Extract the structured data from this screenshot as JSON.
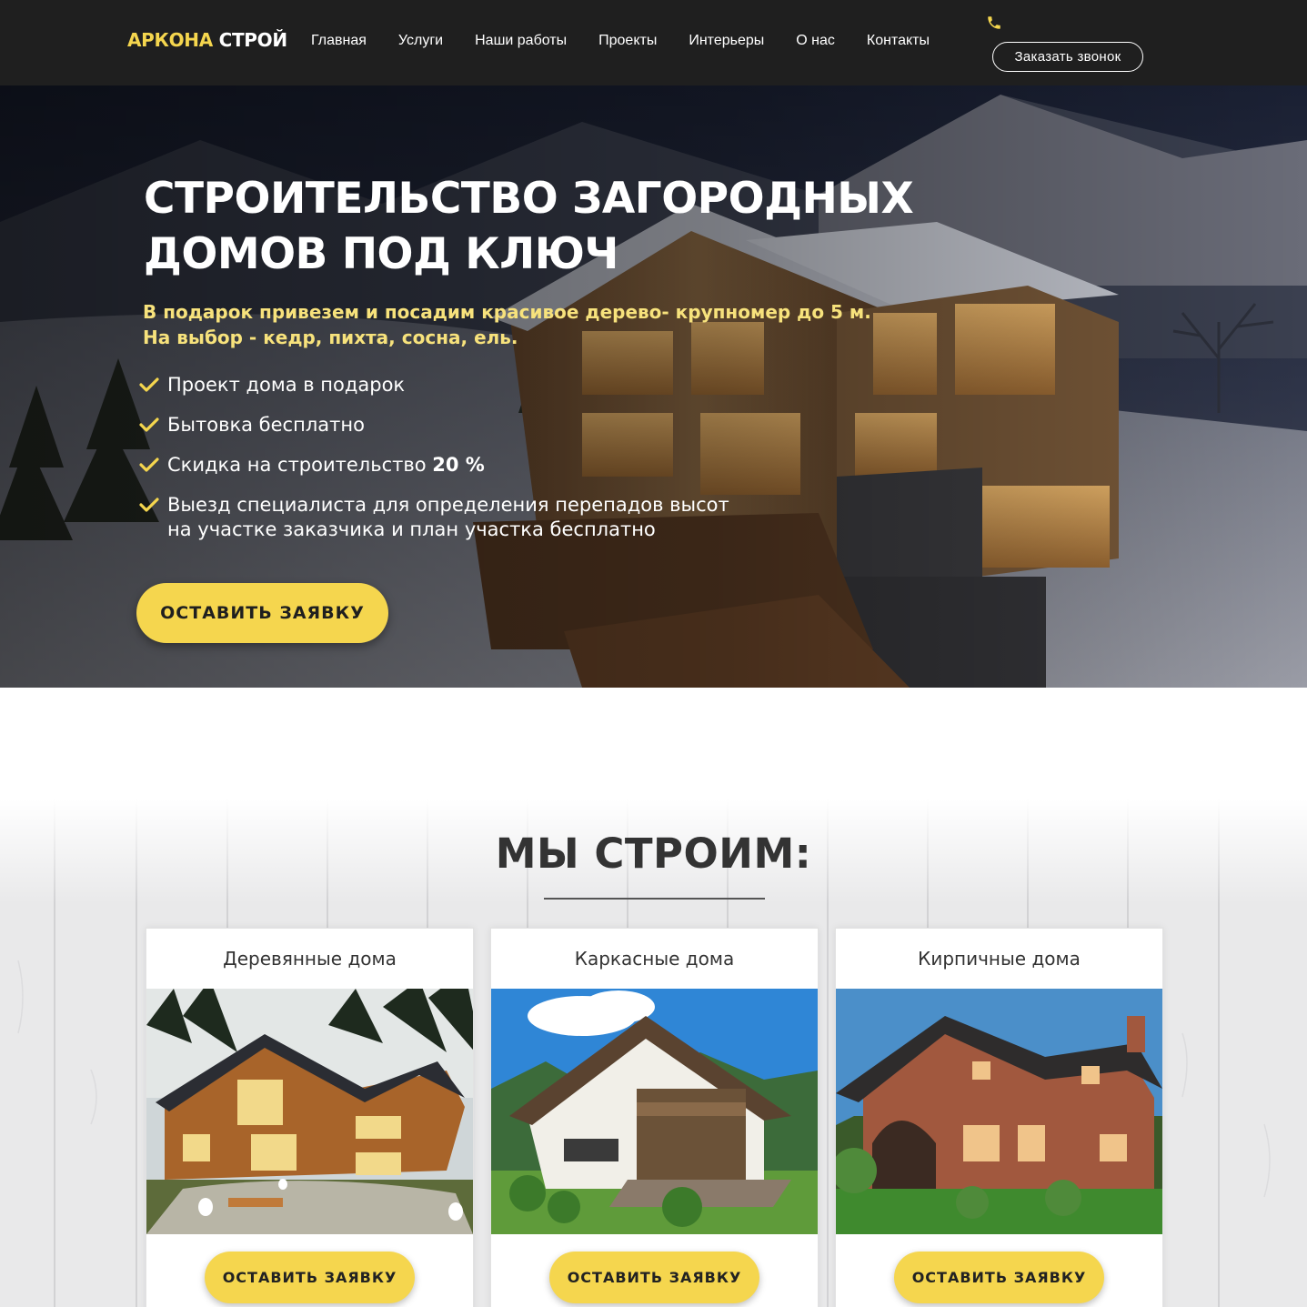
{
  "nav": {
    "logo_accent": "АРКОНА",
    "logo_rest": " СТРОЙ",
    "menu": [
      "Главная",
      "Услуги",
      "Наши работы",
      "Проекты",
      "Интерьеры",
      "О нас",
      "Контакты"
    ],
    "call_button": "Заказать звонок",
    "phone_icon": "phone-icon"
  },
  "hero": {
    "title_line1": "СТРОИТЕЛЬСТВО ЗАГОРОДНЫХ",
    "title_line2": "ДОМОВ ПОД КЛЮЧ",
    "subtitle_line1": "В подарок привезем и посадим красивое дерево- крупномер до 5 м.",
    "subtitle_line2": "На выбор - кедр, пихта, сосна, ель.",
    "features": [
      {
        "text": "Проект дома в подарок"
      },
      {
        "text": "Бытовка бесплатно"
      },
      {
        "text": "Скидка на строительство ",
        "bold": "20 %"
      },
      {
        "text": "Выезд специалиста для определения перепадов высот",
        "line2": "на участке заказчика и план участка бесплатно"
      }
    ],
    "cta": "ОСТАВИТЬ ЗАЯВКУ"
  },
  "section": {
    "title": "МЫ СТРОИМ:",
    "cards": [
      {
        "title": "Деревянные дома",
        "button": "ОСТАВИТЬ ЗАЯВКУ"
      },
      {
        "title": "Каркасные дома",
        "button": "ОСТАВИТЬ ЗАЯВКУ"
      },
      {
        "title": "Кирпичные дома",
        "button": "ОСТАВИТЬ ЗАЯВКУ"
      }
    ]
  },
  "colors": {
    "accent": "#f5d64e",
    "nav_bg": "#1f1f1f",
    "subtitle": "#f7e27c"
  }
}
